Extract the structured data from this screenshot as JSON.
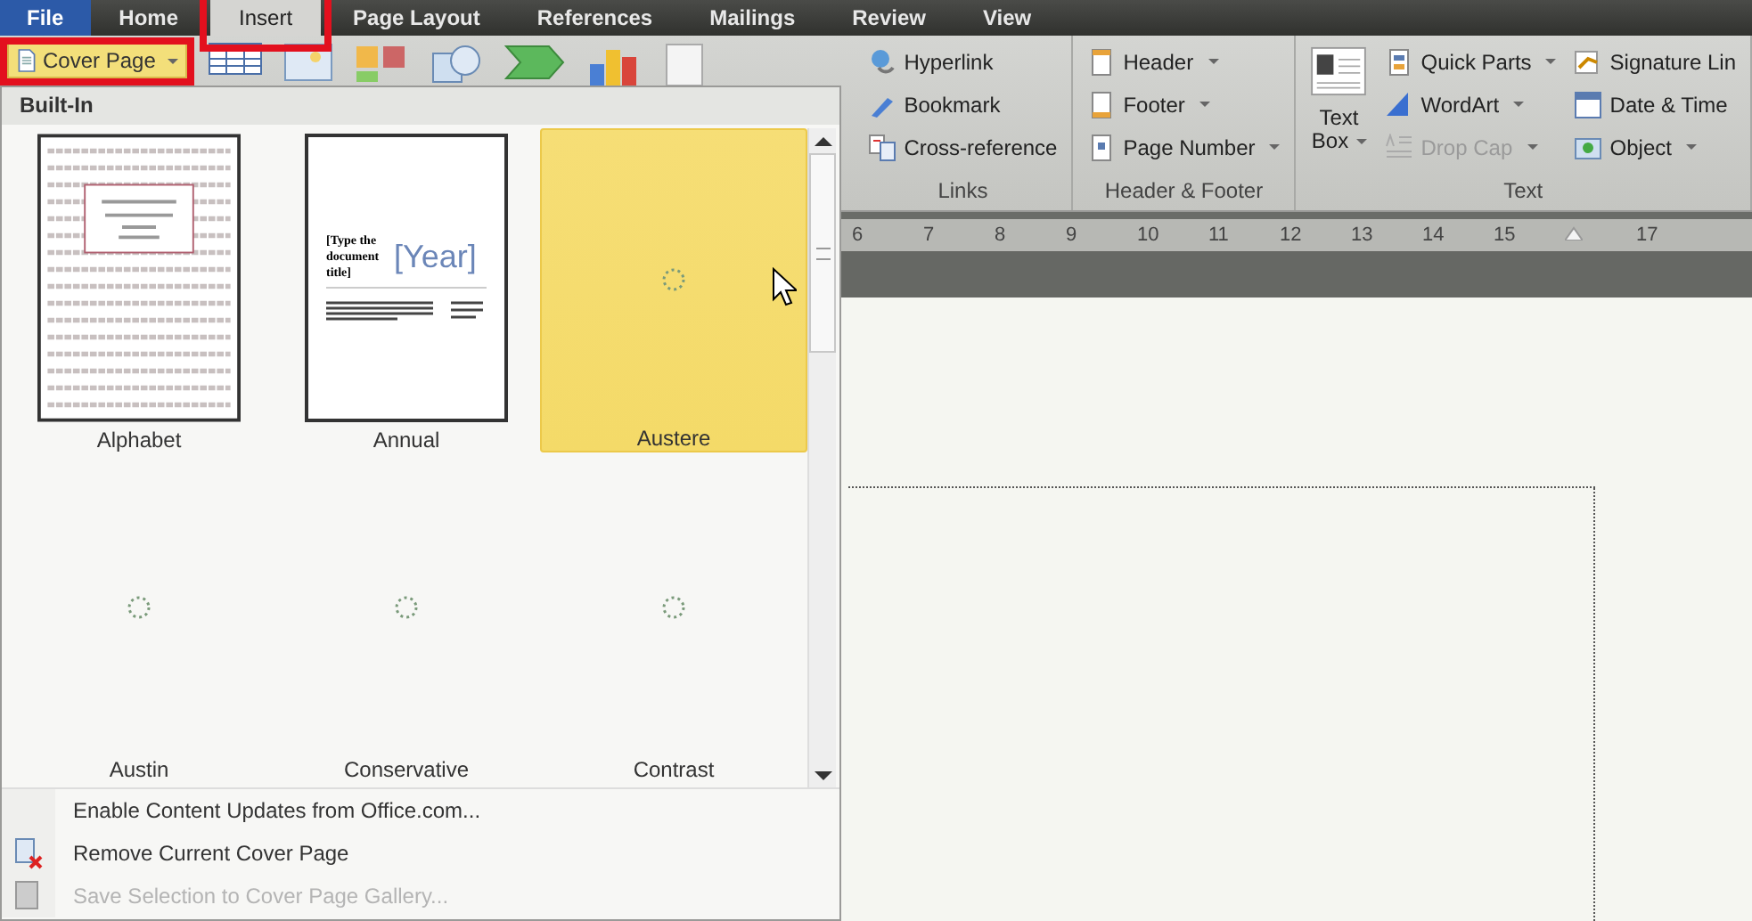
{
  "tabs": [
    {
      "label": "File",
      "kind": "file",
      "selected": false,
      "annotated": false
    },
    {
      "label": "Home",
      "kind": "tab",
      "selected": false,
      "annotated": false
    },
    {
      "label": "Insert",
      "kind": "tab",
      "selected": true,
      "annotated": true
    },
    {
      "label": "Page Layout",
      "kind": "tab",
      "selected": false,
      "annotated": false
    },
    {
      "label": "References",
      "kind": "tab",
      "selected": false,
      "annotated": false
    },
    {
      "label": "Mailings",
      "kind": "tab",
      "selected": false,
      "annotated": false
    },
    {
      "label": "Review",
      "kind": "tab",
      "selected": false,
      "annotated": false
    },
    {
      "label": "View",
      "kind": "tab",
      "selected": false,
      "annotated": false
    }
  ],
  "cover_page_button": {
    "label": "Cover Page",
    "annotated": true
  },
  "ribbon_groups": [
    {
      "label": "Links",
      "items": [
        {
          "label": "Hyperlink",
          "dropdown": false,
          "disabled": false
        },
        {
          "label": "Bookmark",
          "dropdown": false,
          "disabled": false
        },
        {
          "label": "Cross-reference",
          "dropdown": false,
          "disabled": false
        }
      ]
    },
    {
      "label": "Header & Footer",
      "items": [
        {
          "label": "Header",
          "dropdown": true,
          "disabled": false
        },
        {
          "label": "Footer",
          "dropdown": true,
          "disabled": false
        },
        {
          "label": "Page Number",
          "dropdown": true,
          "disabled": false
        }
      ]
    },
    {
      "label": "Text",
      "big": {
        "line1": "Text",
        "line2": "Box"
      },
      "items": [
        {
          "label": "Quick Parts",
          "dropdown": true,
          "disabled": false
        },
        {
          "label": "WordArt",
          "dropdown": true,
          "disabled": false
        },
        {
          "label": "Drop Cap",
          "dropdown": true,
          "disabled": true
        }
      ],
      "items2": [
        {
          "label": "Signature Lin",
          "dropdown": false,
          "disabled": false
        },
        {
          "label": "Date & Time",
          "dropdown": false,
          "disabled": false
        },
        {
          "label": "Object",
          "dropdown": true,
          "disabled": false
        }
      ]
    }
  ],
  "ruler": [
    "6",
    "7",
    "8",
    "9",
    "10",
    "11",
    "12",
    "13",
    "14",
    "15",
    "17"
  ],
  "menu": {
    "heading": "Built-In",
    "gallery": [
      {
        "label": "Alphabet",
        "kind": "alphabet",
        "selected": false
      },
      {
        "label": "Annual",
        "kind": "annual",
        "selected": false,
        "title": "[Type the document title]",
        "year": "[Year]"
      },
      {
        "label": "Austere",
        "kind": "loading",
        "selected": true
      },
      {
        "label": "Austin",
        "kind": "loading",
        "selected": false
      },
      {
        "label": "Conservative",
        "kind": "loading",
        "selected": false
      },
      {
        "label": "Contrast",
        "kind": "loading",
        "selected": false
      }
    ],
    "items": [
      {
        "label": "Enable Content Updates from Office.com...",
        "disabled": false
      },
      {
        "label": "Remove Current Cover Page",
        "disabled": false
      },
      {
        "label": "Save Selection to Cover Page Gallery...",
        "disabled": true
      }
    ]
  }
}
